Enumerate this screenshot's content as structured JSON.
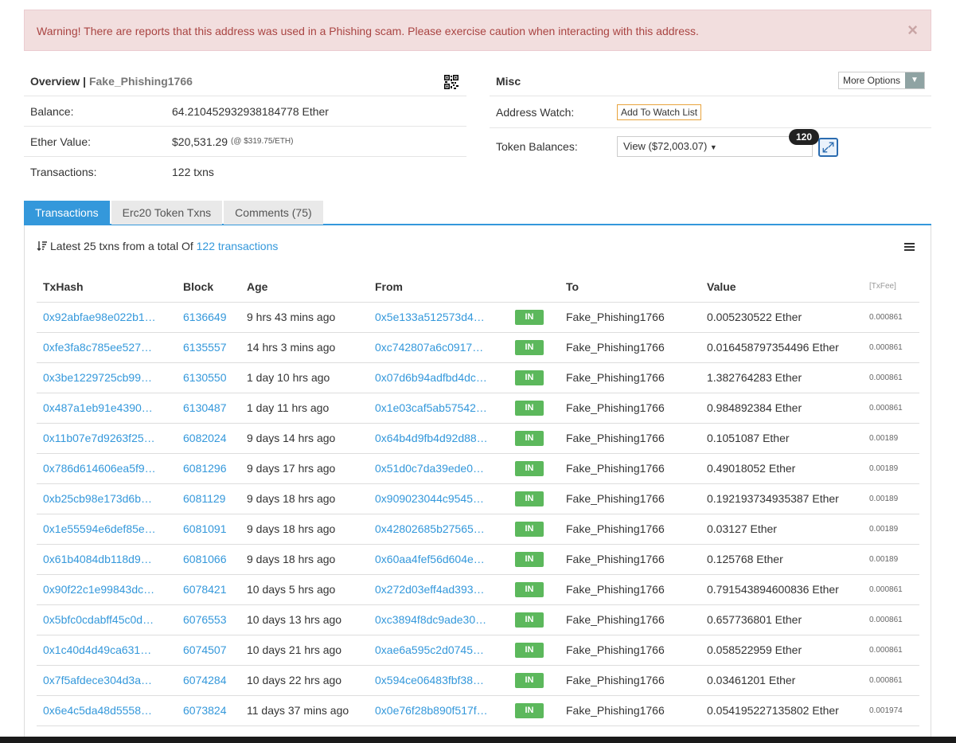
{
  "alert": {
    "text": "Warning! There are reports that this address was used in a Phishing scam. Please exercise caution when interacting with this address.",
    "close": "×"
  },
  "overview": {
    "title": "Overview",
    "separator": " | ",
    "name": "Fake_Phishing1766",
    "balance_label": "Balance:",
    "balance_value": "64.210452932938184778 Ether",
    "ether_value_label": "Ether Value:",
    "ether_value": "$20,531.29",
    "ether_price": "(@ $319.75/ETH)",
    "transactions_label": "Transactions:",
    "transactions_value": "122 txns"
  },
  "misc": {
    "title": "Misc",
    "more_options": "More Options",
    "address_watch_label": "Address Watch:",
    "add_watch_button": "Add To Watch List",
    "token_balances_label": "Token Balances:",
    "token_view": "View ($72,003.07)",
    "token_count": "120"
  },
  "tabs": [
    {
      "label": "Transactions"
    },
    {
      "label": "Erc20 Token Txns"
    },
    {
      "label": "Comments (75)"
    }
  ],
  "summary": {
    "prefix": "Latest 25 txns from a total Of ",
    "link": "122 transactions"
  },
  "table": {
    "headers": [
      "TxHash",
      "Block",
      "Age",
      "From",
      "To",
      "Value",
      "[TxFee]"
    ],
    "rows": [
      {
        "hash": "0x92abfae98e022b1…",
        "block": "6136649",
        "age": "9 hrs 43 mins ago",
        "from": "0x5e133a512573d4…",
        "dir": "IN",
        "to": "Fake_Phishing1766",
        "value": "0.005230522 Ether",
        "fee": "0.000861"
      },
      {
        "hash": "0xfe3fa8c785ee527…",
        "block": "6135557",
        "age": "14 hrs 3 mins ago",
        "from": "0xc742807a6c0917…",
        "dir": "IN",
        "to": "Fake_Phishing1766",
        "value": "0.016458797354496 Ether",
        "fee": "0.000861"
      },
      {
        "hash": "0x3be1229725cb99…",
        "block": "6130550",
        "age": "1 day 10 hrs ago",
        "from": "0x07d6b94adfbd4dc…",
        "dir": "IN",
        "to": "Fake_Phishing1766",
        "value": "1.382764283 Ether",
        "fee": "0.000861"
      },
      {
        "hash": "0x487a1eb91e4390…",
        "block": "6130487",
        "age": "1 day 11 hrs ago",
        "from": "0x1e03caf5ab57542…",
        "dir": "IN",
        "to": "Fake_Phishing1766",
        "value": "0.984892384 Ether",
        "fee": "0.000861"
      },
      {
        "hash": "0x11b07e7d9263f25…",
        "block": "6082024",
        "age": "9 days 14 hrs ago",
        "from": "0x64b4d9fb4d92d88…",
        "dir": "IN",
        "to": "Fake_Phishing1766",
        "value": "0.1051087 Ether",
        "fee": "0.00189"
      },
      {
        "hash": "0x786d614606ea5f9…",
        "block": "6081296",
        "age": "9 days 17 hrs ago",
        "from": "0x51d0c7da39ede0…",
        "dir": "IN",
        "to": "Fake_Phishing1766",
        "value": "0.49018052 Ether",
        "fee": "0.00189"
      },
      {
        "hash": "0xb25cb98e173d6b…",
        "block": "6081129",
        "age": "9 days 18 hrs ago",
        "from": "0x909023044c9545…",
        "dir": "IN",
        "to": "Fake_Phishing1766",
        "value": "0.192193734935387 Ether",
        "fee": "0.00189"
      },
      {
        "hash": "0x1e55594e6def85e…",
        "block": "6081091",
        "age": "9 days 18 hrs ago",
        "from": "0x42802685b27565…",
        "dir": "IN",
        "to": "Fake_Phishing1766",
        "value": "0.03127 Ether",
        "fee": "0.00189"
      },
      {
        "hash": "0x61b4084db118d9…",
        "block": "6081066",
        "age": "9 days 18 hrs ago",
        "from": "0x60aa4fef56d604e…",
        "dir": "IN",
        "to": "Fake_Phishing1766",
        "value": "0.125768 Ether",
        "fee": "0.00189"
      },
      {
        "hash": "0x90f22c1e99843dc…",
        "block": "6078421",
        "age": "10 days 5 hrs ago",
        "from": "0x272d03eff4ad393…",
        "dir": "IN",
        "to": "Fake_Phishing1766",
        "value": "0.791543894600836 Ether",
        "fee": "0.000861"
      },
      {
        "hash": "0x5bfc0cdabff45c0d…",
        "block": "6076553",
        "age": "10 days 13 hrs ago",
        "from": "0xc3894f8dc9ade30…",
        "dir": "IN",
        "to": "Fake_Phishing1766",
        "value": "0.657736801 Ether",
        "fee": "0.000861"
      },
      {
        "hash": "0x1c40d4d49ca631…",
        "block": "6074507",
        "age": "10 days 21 hrs ago",
        "from": "0xae6a595c2d0745…",
        "dir": "IN",
        "to": "Fake_Phishing1766",
        "value": "0.058522959 Ether",
        "fee": "0.000861"
      },
      {
        "hash": "0x7f5afdece304d3a…",
        "block": "6074284",
        "age": "10 days 22 hrs ago",
        "from": "0x594ce06483fbf38…",
        "dir": "IN",
        "to": "Fake_Phishing1766",
        "value": "0.03461201 Ether",
        "fee": "0.000861"
      },
      {
        "hash": "0x6e4c5da48d5558…",
        "block": "6073824",
        "age": "11 days 37 mins ago",
        "from": "0x0e76f28b890f517f…",
        "dir": "IN",
        "to": "Fake_Phishing1766",
        "value": "0.054195227135802 Ether",
        "fee": "0.001974"
      }
    ]
  },
  "colors": {
    "accent": "#3498db",
    "in_badge": "#5cb85c",
    "alert_bg": "#f2dede",
    "alert_text": "#a94442"
  }
}
